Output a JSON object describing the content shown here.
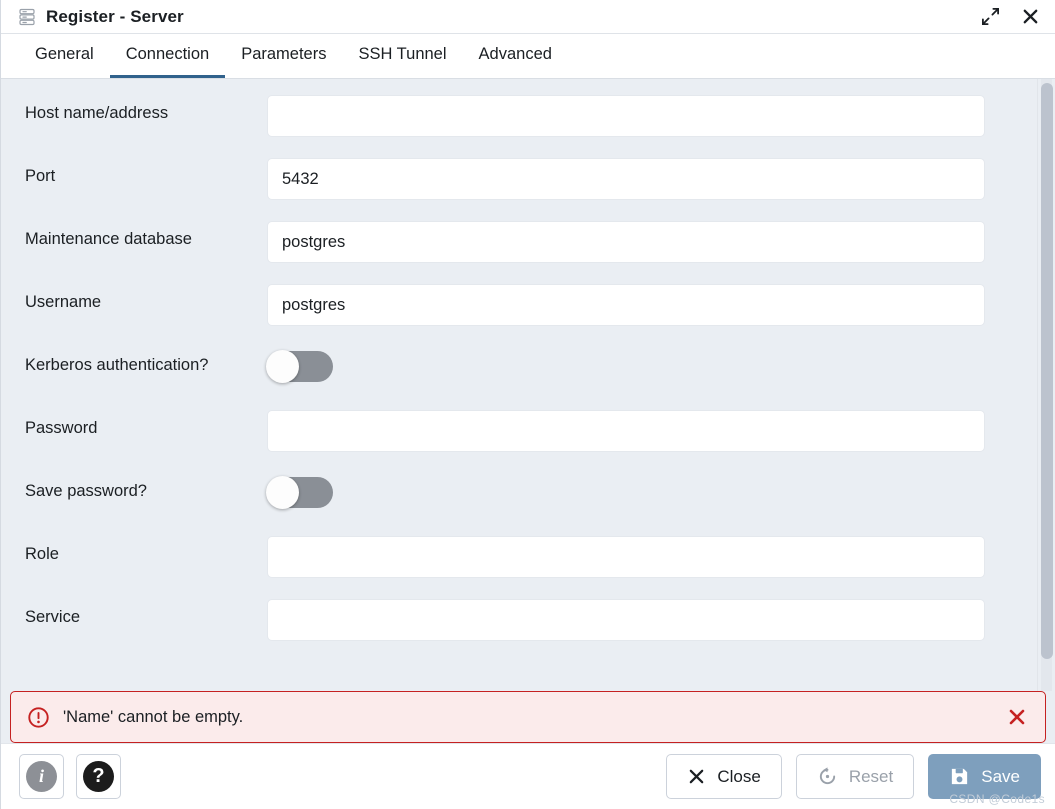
{
  "window": {
    "title": "Register - Server",
    "icon": "server-stack-icon",
    "expand_icon": "expand-diagonal-icon",
    "close_icon": "close-x-icon"
  },
  "tabs": [
    {
      "label": "General",
      "active": false
    },
    {
      "label": "Connection",
      "active": true
    },
    {
      "label": "Parameters",
      "active": false
    },
    {
      "label": "SSH Tunnel",
      "active": false
    },
    {
      "label": "Advanced",
      "active": false
    }
  ],
  "form": {
    "fields": [
      {
        "label": "Host name/address",
        "type": "text",
        "value": "",
        "placeholder": ""
      },
      {
        "label": "Port",
        "type": "text",
        "value": "5432",
        "placeholder": ""
      },
      {
        "label": "Maintenance database",
        "type": "text",
        "value": "postgres",
        "placeholder": ""
      },
      {
        "label": "Username",
        "type": "text",
        "value": "postgres",
        "placeholder": ""
      },
      {
        "label": "Kerberos authentication?",
        "type": "toggle",
        "value": "off"
      },
      {
        "label": "Password",
        "type": "text",
        "value": "",
        "placeholder": ""
      },
      {
        "label": "Save password?",
        "type": "toggle",
        "value": "off"
      },
      {
        "label": "Role",
        "type": "text",
        "value": "",
        "placeholder": ""
      },
      {
        "label": "Service",
        "type": "text",
        "value": "",
        "placeholder": ""
      }
    ]
  },
  "error": {
    "message": "'Name' cannot be empty.",
    "icon": "error-circle-exclamation-icon",
    "close_icon": "close-x-icon",
    "border_color": "#c52121",
    "background_color": "#fbebeb"
  },
  "footer": {
    "info_label": "i",
    "help_label": "?",
    "close_label": "Close",
    "reset_label": "Reset",
    "save_label": "Save",
    "reset_disabled": true,
    "save_color": "#7e9fbd"
  },
  "watermark": "CSDN @Code1s",
  "theme": {
    "accent": "#31628c",
    "body_background": "#eaeef3",
    "panel_background": "#ffffff"
  }
}
